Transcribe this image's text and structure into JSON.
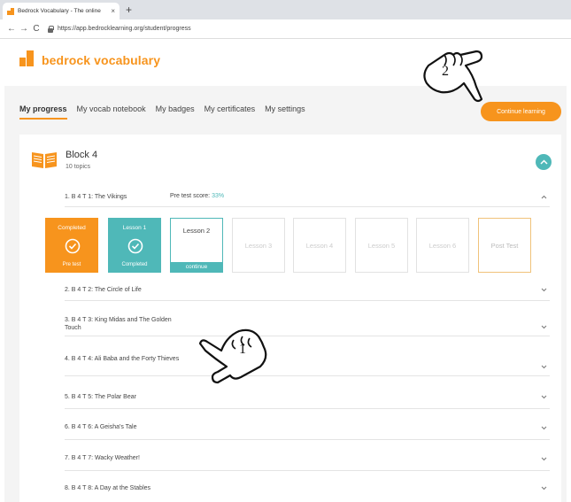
{
  "browser": {
    "tab_title": "Bedrock Vocabulary - The online",
    "tab_close": "×",
    "new_tab": "+",
    "back": "←",
    "forward": "→",
    "reload": "C",
    "url": "https://app.bedrocklearning.org/student/progress"
  },
  "header": {
    "logo_text": "bedrock vocabulary",
    "continue_label": "Continue learning"
  },
  "nav": {
    "items": [
      "My progress",
      "My vocab notebook",
      "My badges",
      "My certificates",
      "My settings"
    ]
  },
  "block": {
    "title": "Block 4",
    "subtitle": "10 topics"
  },
  "topics": [
    {
      "label": "1.  B 4 T 1: The Vikings",
      "pretest_label": "Pre test score:",
      "pretest_score": "33%"
    },
    {
      "label": "2.  B 4 T 2: The Circle of Life"
    },
    {
      "label": "3.  B 4 T 3: King Midas and The Golden Touch"
    },
    {
      "label": "4.  B 4 T 4: Ali Baba and the Forty Thieves"
    },
    {
      "label": "5.  B 4 T 5: The Polar Bear"
    },
    {
      "label": "6.  B 4 T 6: A Geisha's Tale"
    },
    {
      "label": "7.  B 4 T 7: Wacky Weather!"
    },
    {
      "label": "8.  B 4 T 8: A Day at the Stables"
    }
  ],
  "lessons": [
    {
      "top": "Completed",
      "bottom": "Pre test"
    },
    {
      "top": "Lesson 1",
      "bottom": "Completed"
    },
    {
      "top": "Lesson 2",
      "bottom": "continue"
    },
    {
      "top": "Lesson 3"
    },
    {
      "top": "Lesson 4"
    },
    {
      "top": "Lesson 5"
    },
    {
      "top": "Lesson 6"
    },
    {
      "top": "Post Test"
    }
  ],
  "annotations": {
    "hand1": "1",
    "hand2": "2"
  },
  "colors": {
    "brand_orange": "#f7941d",
    "teal": "#4fb8b8"
  }
}
